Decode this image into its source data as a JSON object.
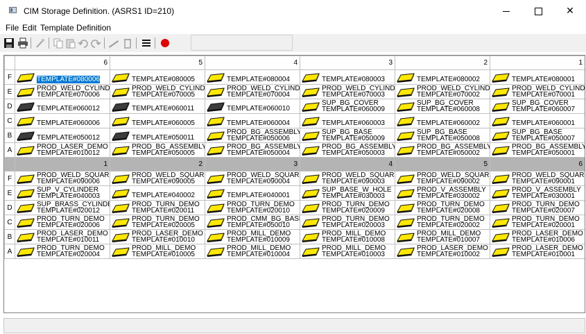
{
  "window": {
    "title": "CIM Storage Definition.  (ASRS1 ID=210)",
    "minimize": "—",
    "maximize": "□",
    "close": "✕"
  },
  "menu": [
    "File",
    "Edit",
    "Template Definition"
  ],
  "toolbar": {
    "icons": [
      "save-icon",
      "print-icon",
      "wand-icon",
      "copy-icon",
      "paste-icon",
      "undo-icon",
      "redo-icon",
      "ruler-icon",
      "delete-icon",
      "list-icon",
      "record-icon"
    ]
  },
  "colors": {
    "tray_yellow": "#ffe800",
    "tray_dark": "#3c3c3c",
    "selection": "#0078d7",
    "dark_header": "#b4b4b4"
  },
  "upper_rack": {
    "columns": [
      "6",
      "5",
      "4",
      "3",
      "2",
      "1"
    ],
    "rows": [
      {
        "label": "F",
        "cells": [
          {
            "lines": [
              "TEMPLATE#080006"
            ],
            "tray": "yellow",
            "selected": true
          },
          {
            "lines": [
              "TEMPLATE#080005"
            ],
            "tray": "yellow"
          },
          {
            "lines": [
              "TEMPLATE#080004"
            ],
            "tray": "yellow"
          },
          {
            "lines": [
              "TEMPLATE#080003"
            ],
            "tray": "yellow"
          },
          {
            "lines": [
              "TEMPLATE#080002"
            ],
            "tray": "yellow"
          },
          {
            "lines": [
              "TEMPLATE#080001"
            ],
            "tray": "yellow"
          }
        ]
      },
      {
        "label": "E",
        "cells": [
          {
            "lines": [
              "PROD_WELD_CYLIND",
              "TEMPLATE#070006"
            ],
            "tray": "yellow"
          },
          {
            "lines": [
              "PROD_WELD_CYLIND",
              "TEMPLATE#070005"
            ],
            "tray": "yellow"
          },
          {
            "lines": [
              "PROD_WELD_CYLIND",
              "TEMPLATE#070004"
            ],
            "tray": "yellow"
          },
          {
            "lines": [
              "PROD_WELD_CYLIND",
              "TEMPLATE#070003"
            ],
            "tray": "yellow"
          },
          {
            "lines": [
              "PROD_WELD_CYLIND",
              "TEMPLATE#070002"
            ],
            "tray": "yellow"
          },
          {
            "lines": [
              "PROD_WELD_CYLIND",
              "TEMPLATE#070001"
            ],
            "tray": "yellow"
          }
        ]
      },
      {
        "label": "D",
        "cells": [
          {
            "lines": [
              "TEMPLATE#060012"
            ],
            "tray": "dark"
          },
          {
            "lines": [
              "TEMPLATE#060011"
            ],
            "tray": "dark"
          },
          {
            "lines": [
              "TEMPLATE#060010"
            ],
            "tray": "dark"
          },
          {
            "lines": [
              "SUP_BG_COVER",
              "TEMPLATE#060009"
            ],
            "tray": "yellow"
          },
          {
            "lines": [
              "SUP_BG_COVER",
              "TEMPLATE#060008"
            ],
            "tray": "yellow"
          },
          {
            "lines": [
              "SUP_BG_COVER",
              "TEMPLATE#060007"
            ],
            "tray": "yellow"
          }
        ]
      },
      {
        "label": "C",
        "cells": [
          {
            "lines": [
              "TEMPLATE#060006"
            ],
            "tray": "yellow"
          },
          {
            "lines": [
              "TEMPLATE#060005"
            ],
            "tray": "yellow"
          },
          {
            "lines": [
              "TEMPLATE#060004"
            ],
            "tray": "yellow"
          },
          {
            "lines": [
              "TEMPLATE#060003"
            ],
            "tray": "yellow"
          },
          {
            "lines": [
              "TEMPLATE#060002"
            ],
            "tray": "yellow"
          },
          {
            "lines": [
              "TEMPLATE#060001"
            ],
            "tray": "yellow"
          }
        ]
      },
      {
        "label": "B",
        "cells": [
          {
            "lines": [
              "TEMPLATE#050012"
            ],
            "tray": "dark"
          },
          {
            "lines": [
              "TEMPLATE#050011"
            ],
            "tray": "dark"
          },
          {
            "lines": [
              "PROD_BG_ASSEMBLY",
              "TEMPLATE#050006"
            ],
            "tray": "yellow"
          },
          {
            "lines": [
              "SUP_BG_BASE",
              "TEMPLATE#050009"
            ],
            "tray": "yellow"
          },
          {
            "lines": [
              "SUP_BG_BASE",
              "TEMPLATE#050008"
            ],
            "tray": "yellow"
          },
          {
            "lines": [
              "SUP_BG_BASE",
              "TEMPLATE#050007"
            ],
            "tray": "yellow"
          }
        ]
      },
      {
        "label": "A",
        "cells": [
          {
            "lines": [
              "PROD_LASER_DEMO",
              "TEMPLATE#010012"
            ],
            "tray": "yellow"
          },
          {
            "lines": [
              "PROD_BG_ASSEMBLY",
              "TEMPLATE#050005"
            ],
            "tray": "yellow"
          },
          {
            "lines": [
              "PROD_BG_ASSEMBLY",
              "TEMPLATE#050004"
            ],
            "tray": "yellow"
          },
          {
            "lines": [
              "PROD_BG_ASSEMBLY",
              "TEMPLATE#050003"
            ],
            "tray": "yellow"
          },
          {
            "lines": [
              "PROD_BG_ASSEMBLY",
              "TEMPLATE#050002"
            ],
            "tray": "yellow"
          },
          {
            "lines": [
              "PROD_BG_ASSEMBLY",
              "TEMPLATE#050001"
            ],
            "tray": "yellow"
          }
        ]
      }
    ]
  },
  "lower_rack": {
    "columns": [
      "1",
      "2",
      "3",
      "4",
      "5",
      "6"
    ],
    "rows": [
      {
        "label": "F",
        "cells": [
          {
            "lines": [
              "PROD_WELD_SQUARI",
              "TEMPLATE#090006"
            ],
            "tray": "yellow"
          },
          {
            "lines": [
              "PROD_WELD_SQUARI",
              "TEMPLATE#090005"
            ],
            "tray": "yellow"
          },
          {
            "lines": [
              "PROD_WELD_SQUARI",
              "TEMPLATE#090004"
            ],
            "tray": "yellow"
          },
          {
            "lines": [
              "PROD_WELD_SQUARI",
              "TEMPLATE#090003"
            ],
            "tray": "yellow"
          },
          {
            "lines": [
              "PROD_WELD_SQUARI",
              "TEMPLATE#090002"
            ],
            "tray": "yellow"
          },
          {
            "lines": [
              "PROD_WELD_SQUARI",
              "TEMPLATE#090001"
            ],
            "tray": "yellow"
          }
        ]
      },
      {
        "label": "E",
        "cells": [
          {
            "lines": [
              "SUP_V_CYLINDER",
              "TEMPLATE#040003"
            ],
            "tray": "yellow"
          },
          {
            "lines": [
              "TEMPLATE#040002"
            ],
            "tray": "yellow"
          },
          {
            "lines": [
              "TEMPLATE#040001"
            ],
            "tray": "yellow"
          },
          {
            "lines": [
              "SUP_BASE_W_HOLE",
              "TEMPLATE#030003"
            ],
            "tray": "yellow"
          },
          {
            "lines": [
              "PROD_V_ASSEMBLY",
              "TEMPLATE#030002"
            ],
            "tray": "yellow"
          },
          {
            "lines": [
              "PROD_V_ASSEMBLY",
              "TEMPLATE#030001"
            ],
            "tray": "yellow"
          }
        ]
      },
      {
        "label": "D",
        "cells": [
          {
            "lines": [
              "SUP_BRASS_CYLINDE",
              "TEMPLATE#020012"
            ],
            "tray": "yellow"
          },
          {
            "lines": [
              "PROD_TURN_DEMO",
              "TEMPLATE#020011"
            ],
            "tray": "yellow"
          },
          {
            "lines": [
              "PROD_TURN_DEMO",
              "TEMPLATE#020010"
            ],
            "tray": "yellow"
          },
          {
            "lines": [
              "PROD_TURN_DEMO",
              "TEMPLATE#020009"
            ],
            "tray": "yellow"
          },
          {
            "lines": [
              "PROD_TURN_DEMO",
              "TEMPLATE#020008"
            ],
            "tray": "yellow"
          },
          {
            "lines": [
              "PROD_TURN_DEMO",
              "TEMPLATE#020007"
            ],
            "tray": "yellow"
          }
        ]
      },
      {
        "label": "C",
        "cells": [
          {
            "lines": [
              "PROD_TURN_DEMO",
              "TEMPLATE#020006"
            ],
            "tray": "yellow"
          },
          {
            "lines": [
              "PROD_TURN_DEMO",
              "TEMPLATE#020005"
            ],
            "tray": "yellow"
          },
          {
            "lines": [
              "PROD_CMM_BG_BASE",
              "TEMPLATE#050010"
            ],
            "tray": "yellow"
          },
          {
            "lines": [
              "PROD_TURN_DEMO",
              "TEMPLATE#020003"
            ],
            "tray": "yellow"
          },
          {
            "lines": [
              "PROD_TURN_DEMO",
              "TEMPLATE#020002"
            ],
            "tray": "yellow"
          },
          {
            "lines": [
              "PROD_TURN_DEMO",
              "TEMPLATE#020001"
            ],
            "tray": "yellow"
          }
        ]
      },
      {
        "label": "B",
        "cells": [
          {
            "lines": [
              "PROD_LASER_DEMO",
              "TEMPLATE#010011"
            ],
            "tray": "yellow"
          },
          {
            "lines": [
              "PROD_LASER_DEMO",
              "TEMPLATE#010010"
            ],
            "tray": "yellow"
          },
          {
            "lines": [
              "PROD_MILL_DEMO",
              "TEMPLATE#010009"
            ],
            "tray": "yellow"
          },
          {
            "lines": [
              "PROD_MILL_DEMO",
              "TEMPLATE#010008"
            ],
            "tray": "yellow"
          },
          {
            "lines": [
              "PROD_MILL_DEMO",
              "TEMPLATE#010007"
            ],
            "tray": "yellow"
          },
          {
            "lines": [
              "PROD_LASER_DEMO",
              "TEMPLATE#010006"
            ],
            "tray": "yellow"
          }
        ]
      },
      {
        "label": "A",
        "cells": [
          {
            "lines": [
              "PROD_TURN_DEMO",
              "TEMPLATE#020004"
            ],
            "tray": "yellow"
          },
          {
            "lines": [
              "PROD_MILL_DEMO",
              "TEMPLATE#010005"
            ],
            "tray": "yellow"
          },
          {
            "lines": [
              "PROD_MILL_DEMO",
              "TEMPLATE#010004"
            ],
            "tray": "yellow"
          },
          {
            "lines": [
              "PROD_MILL_DEMO",
              "TEMPLATE#010003"
            ],
            "tray": "yellow"
          },
          {
            "lines": [
              "PROD_LASER_DEMO",
              "TEMPLATE#010002"
            ],
            "tray": "yellow"
          },
          {
            "lines": [
              "PROD_LASER_DEMO",
              "TEMPLATE#010001"
            ],
            "tray": "yellow"
          }
        ]
      }
    ]
  },
  "status": ""
}
